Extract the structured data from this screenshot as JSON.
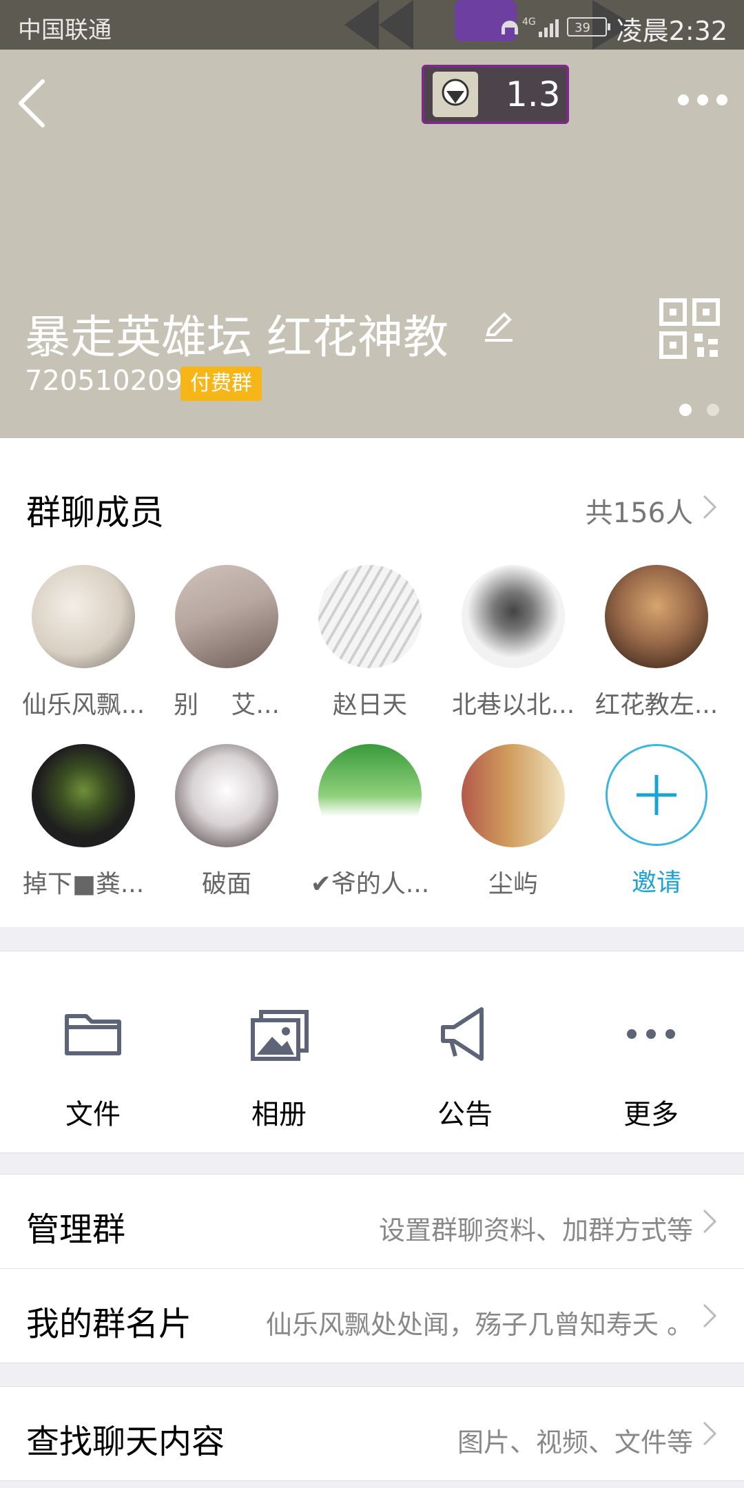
{
  "status_bar": {
    "carrier": "中国联通",
    "network": "4G",
    "battery": "39",
    "time": "凌晨2:32"
  },
  "header": {
    "level": "1.3",
    "group_name": "暴走英雄坛 红花神教",
    "group_id": "720510209",
    "paid_badge": "付费群"
  },
  "members": {
    "title": "群聊成员",
    "count": "共156人",
    "list": [
      {
        "name": "仙乐风飘...",
        "color": "#d9cfc2"
      },
      {
        "name": "别　 艾...",
        "color": "#b7a7a0"
      },
      {
        "name": "赵日天",
        "color": "#e2e2e2"
      },
      {
        "name": "北巷以北...",
        "color": "#f2f2f2"
      },
      {
        "name": "红花教左...",
        "color": "#9a6a4a"
      },
      {
        "name": "掉下■粪...",
        "color": "#1f1f1f"
      },
      {
        "name": "破面",
        "color": "#d8d3d4"
      },
      {
        "name": "✔爷的人...",
        "color": "#5fbf5a"
      },
      {
        "name": "尘屿",
        "color": "#d09c5d"
      }
    ],
    "invite_label": "邀请"
  },
  "actions": [
    {
      "label": "文件",
      "icon": "folder-icon"
    },
    {
      "label": "相册",
      "icon": "album-icon"
    },
    {
      "label": "公告",
      "icon": "megaphone-icon"
    },
    {
      "label": "更多",
      "icon": "more-icon"
    }
  ],
  "rows": {
    "manage": {
      "label": "管理群",
      "value": "设置群聊资料、加群方式等"
    },
    "card": {
      "label": "我的群名片",
      "value": "仙乐风飘处处闻，殇子几曾知寿夭 。"
    },
    "search": {
      "label": "查找聊天内容",
      "value": "图片、视频、文件等"
    }
  }
}
